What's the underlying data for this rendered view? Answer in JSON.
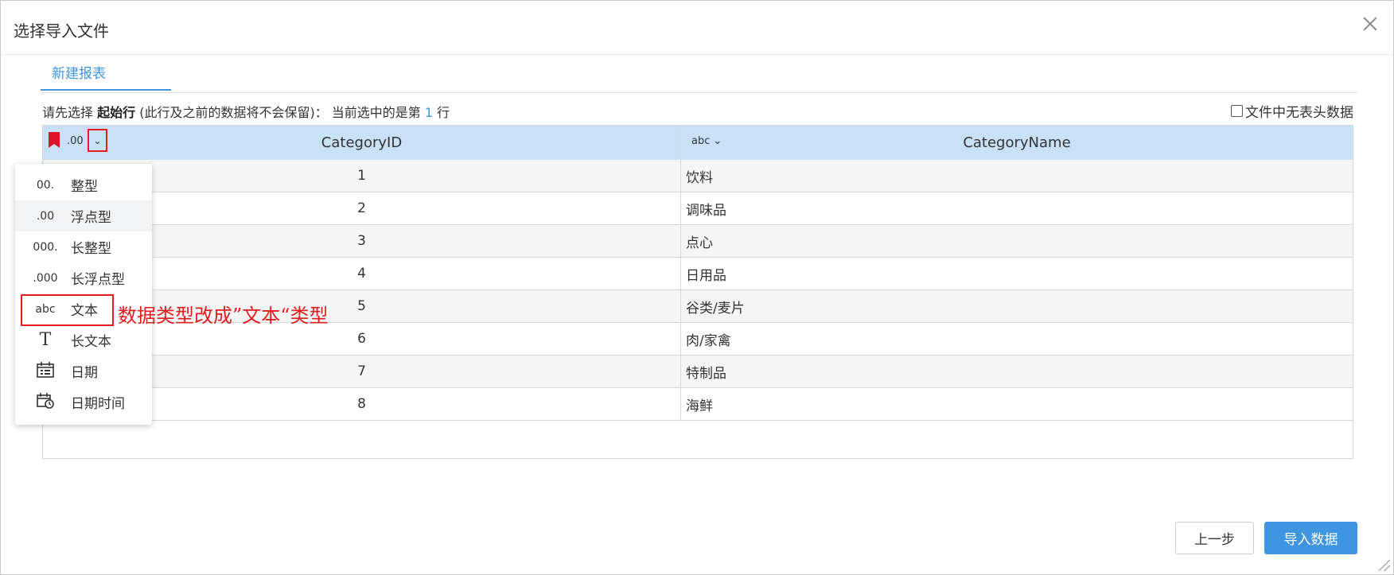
{
  "dialog": {
    "title": "选择导入文件",
    "tab": "新建报表",
    "hint": {
      "prefix": "请先选择",
      "bold": "起始行",
      "middle": "(此行及之前的数据将不会保留)：  当前选中的是第",
      "row_number": "1",
      "suffix": "行"
    },
    "no_header_label": "文件中无表头数据"
  },
  "table": {
    "columns": [
      {
        "type_label": ".00",
        "name": "CategoryID"
      },
      {
        "type_label": "abc",
        "name": "CategoryName"
      }
    ],
    "rows": [
      {
        "id": "1",
        "name": "饮料"
      },
      {
        "id": "2",
        "name": "调味品"
      },
      {
        "id": "3",
        "name": "点心"
      },
      {
        "id": "4",
        "name": "日用品"
      },
      {
        "id": "5",
        "name": "谷类/麦片"
      },
      {
        "id": "6",
        "name": "肉/家禽"
      },
      {
        "id": "7",
        "name": "特制品"
      },
      {
        "id": "8",
        "name": "海鲜"
      }
    ]
  },
  "type_menu": {
    "items": [
      {
        "icon": "00.",
        "label": "整型"
      },
      {
        "icon": ".00",
        "label": "浮点型"
      },
      {
        "icon": "000.",
        "label": "长整型"
      },
      {
        "icon": ".000",
        "label": "长浮点型"
      },
      {
        "icon": "abc",
        "label": "文本"
      },
      {
        "icon": "T",
        "label": "长文本"
      },
      {
        "icon": "calendar-icon",
        "label": "日期"
      },
      {
        "icon": "calendar-clock-icon",
        "label": "日期时间"
      }
    ]
  },
  "annotation": "数据类型改成”文本“类型",
  "buttons": {
    "prev": "上一步",
    "import": "导入数据"
  },
  "colors": {
    "accent": "#3f95e0",
    "header_bg": "#c9e1f7",
    "annotation": "#e11d1d"
  }
}
